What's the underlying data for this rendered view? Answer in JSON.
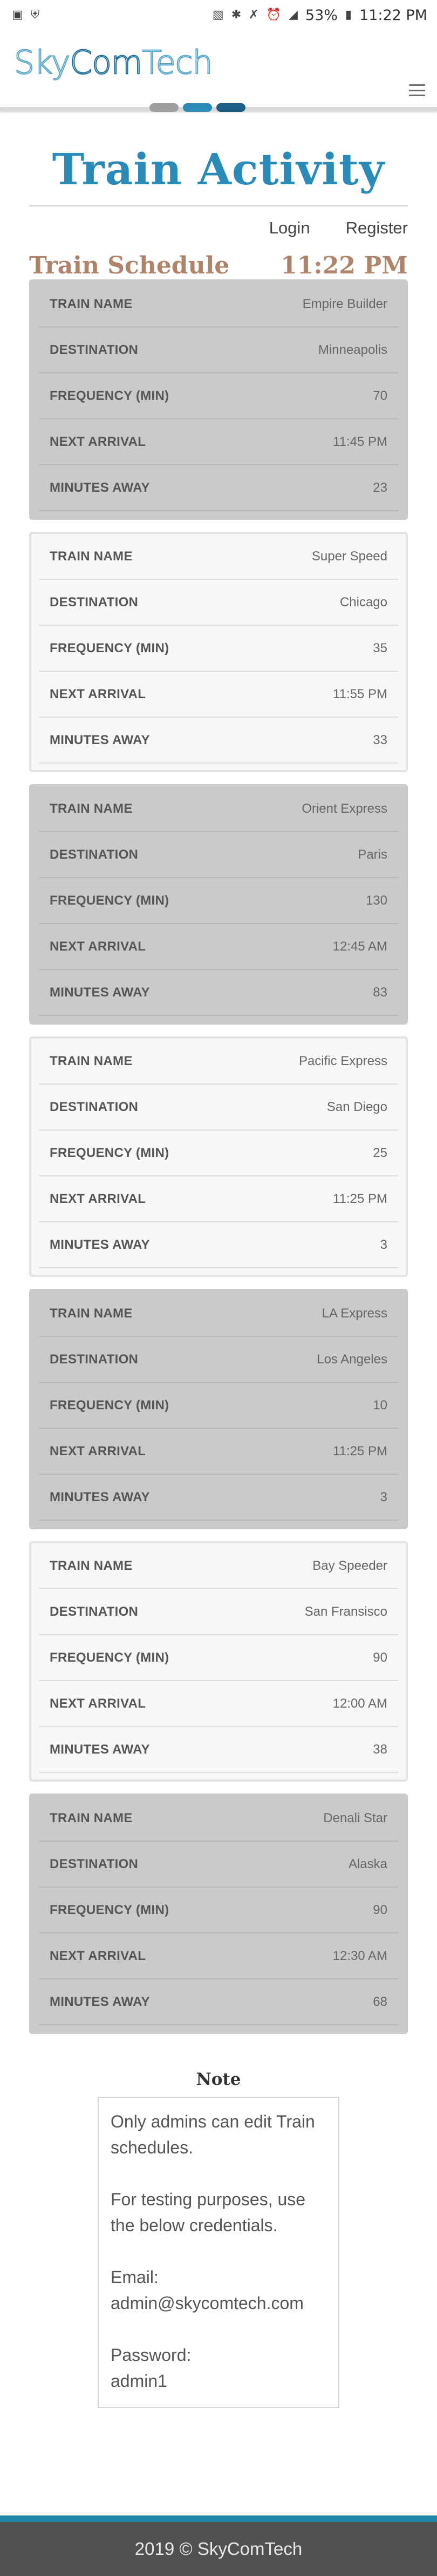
{
  "statusbar": {
    "left_icons": [
      "image-icon",
      "shield-icon"
    ],
    "right_icons": [
      "vibrate-icon",
      "bluetooth-icon",
      "mute-icon",
      "alarm-icon",
      "signal-icon"
    ],
    "battery": "53%",
    "time": "11:22 PM"
  },
  "brand": {
    "part1": "Sky",
    "part2": "Com",
    "part3": "Tech",
    "pill_colors": [
      "#9e9e9e",
      "#2a8ab8",
      "#1d5f87"
    ]
  },
  "header": {
    "title": "Train Activity",
    "login": "Login",
    "register": "Register",
    "schedule_title": "Train Schedule",
    "current_time": "11:22 PM"
  },
  "labels": {
    "name": "Train Name",
    "destination": "Destination",
    "frequency": "Frequency (min)",
    "next_arrival": "Next Arrival",
    "minutes_away": "Minutes Away"
  },
  "trains": [
    {
      "name": "Empire Builder",
      "destination": "Minneapolis",
      "frequency": "70",
      "next_arrival": "11:45 PM",
      "minutes_away": "23"
    },
    {
      "name": "Super Speed",
      "destination": "Chicago",
      "frequency": "35",
      "next_arrival": "11:55 PM",
      "minutes_away": "33"
    },
    {
      "name": "Orient Express",
      "destination": "Paris",
      "frequency": "130",
      "next_arrival": "12:45 AM",
      "minutes_away": "83"
    },
    {
      "name": "Pacific Express",
      "destination": "San Diego",
      "frequency": "25",
      "next_arrival": "11:25 PM",
      "minutes_away": "3"
    },
    {
      "name": "LA Express",
      "destination": "Los Angeles",
      "frequency": "10",
      "next_arrival": "11:25 PM",
      "minutes_away": "3"
    },
    {
      "name": "Bay Speeder",
      "destination": "San Fransisco",
      "frequency": "90",
      "next_arrival": "12:00 AM",
      "minutes_away": "38"
    },
    {
      "name": "Denali Star",
      "destination": "Alaska",
      "frequency": "90",
      "next_arrival": "12:30 AM",
      "minutes_away": "68"
    }
  ],
  "note": {
    "title": "Note",
    "line1": "Only admins can edit Train schedules.",
    "line2": "For testing purposes, use the below credentials.",
    "email_label": "Email:",
    "email": "admin@skycomtech.com",
    "password_label": "Password:",
    "password": "admin1"
  },
  "footer": {
    "text": "2019 © SkyComTech"
  },
  "colors": {
    "title": "#2a8ab8",
    "schedule": "#b0846a",
    "footer_bg": "#515151",
    "footer_accent": "#1f87a6"
  }
}
